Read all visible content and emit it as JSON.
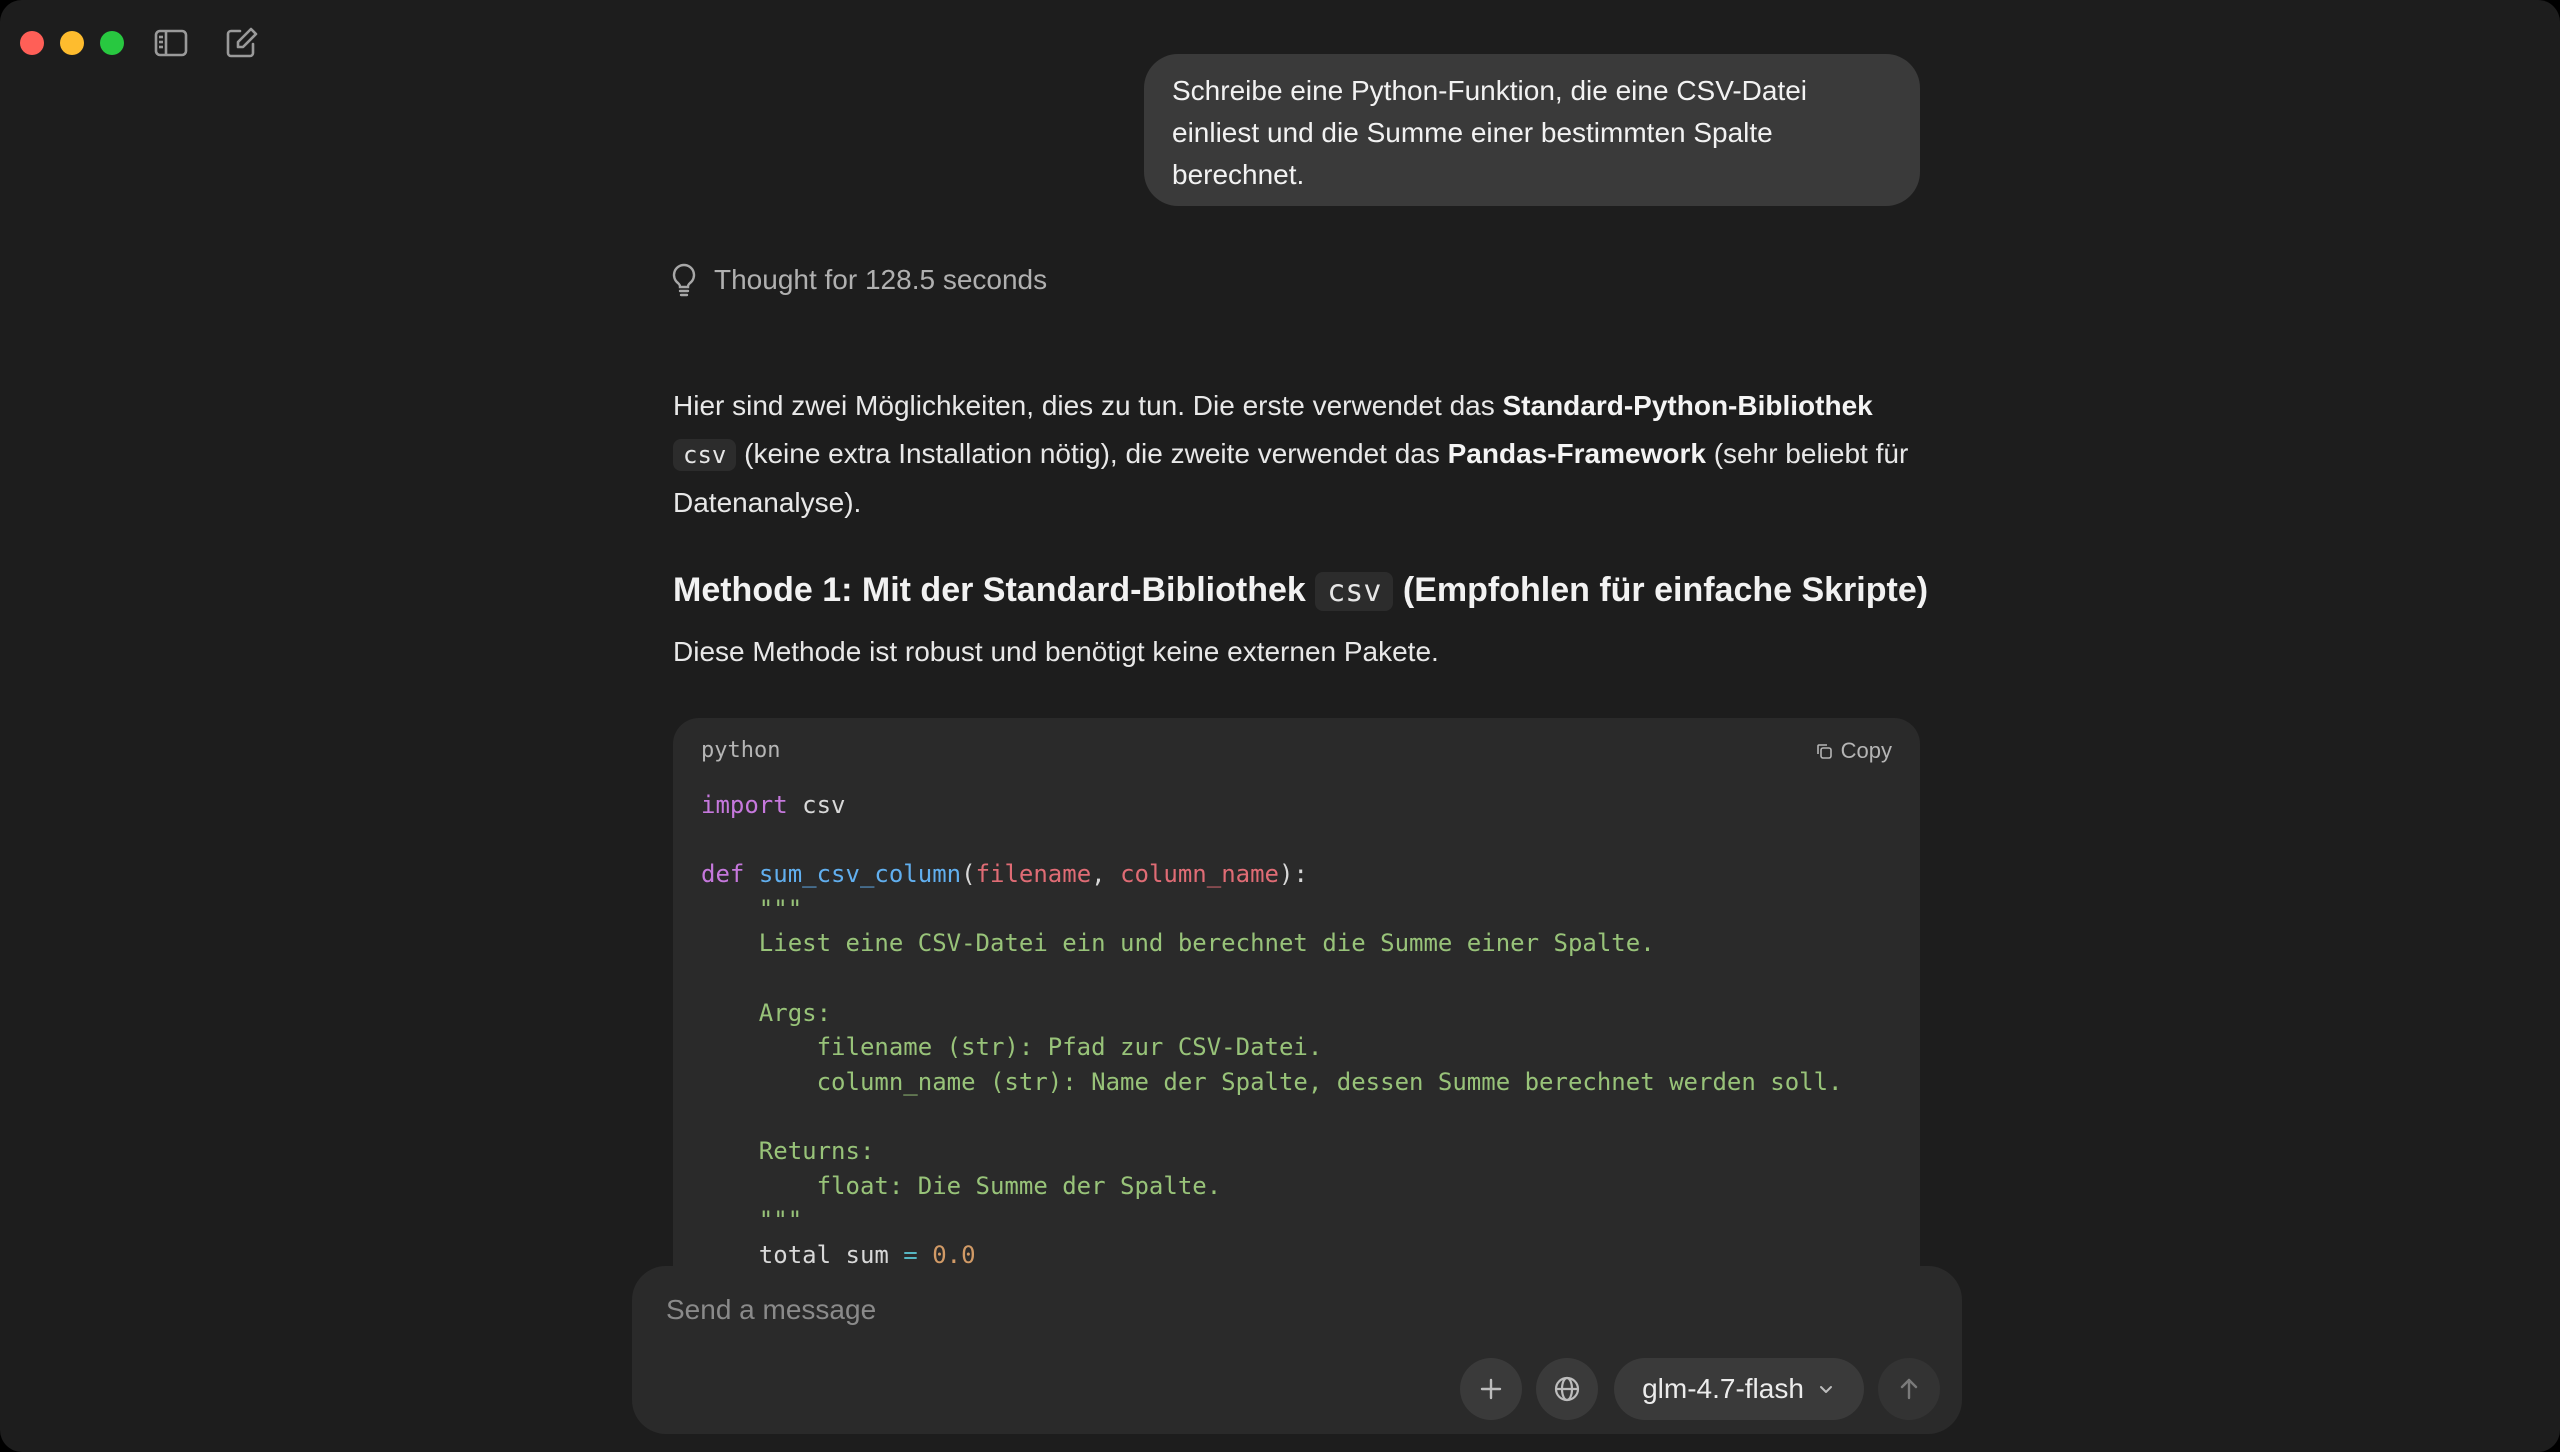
{
  "user_message": "Schreibe eine Python-Funktion, die eine CSV-Datei einliest und die Summe einer bestimmten Spalte berechnet.",
  "thought": {
    "text": "Thought for 128.5 seconds",
    "icon": "lightbulb-icon"
  },
  "intro": {
    "t1": "Hier sind zwei Möglichkeiten, dies zu tun. Die erste verwendet das ",
    "b1": "Standard-Python-Bibliothek",
    "code1": "csv",
    "t2": " (keine extra Installation nötig), die zweite verwendet das ",
    "b2": "Pandas-Framework",
    "t3": " (sehr beliebt für Datenanalyse)."
  },
  "method1": {
    "heading_pre": "Methode 1: Mit der Standard-Bibliothek ",
    "heading_code": "csv",
    "heading_post": " (Empfohlen für einfache Skripte)",
    "description": "Diese Methode ist robust und benötigt keine externen Pakete."
  },
  "code_block": {
    "language": "python",
    "copy_label": "Copy",
    "lines": {
      "l1_kw": "import",
      "l1_rest": " csv",
      "l3_kw": "def",
      "l3_fn": "sum_csv_column",
      "l3_p1": "filename",
      "l3_p2": "column_name",
      "doc_open": "    \"\"\"",
      "doc1": "    Liest eine CSV-Datei ein und berechnet die Summe einer Spalte.",
      "doc_args": "    Args:",
      "doc_arg1": "        filename (str): Pfad zur CSV-Datei.",
      "doc_arg2": "        column_name (str): Name der Spalte, dessen Summe berechnet werden soll.",
      "doc_returns": "    Returns:",
      "doc_ret1": "        float: Die Summe der Spalte.",
      "doc_close": "    \"\"\"",
      "last_var": "    total_sum ",
      "last_op": "=",
      "last_num": "0.0"
    }
  },
  "composer": {
    "placeholder": "Send a message",
    "model": "glm-4.7-flash"
  }
}
